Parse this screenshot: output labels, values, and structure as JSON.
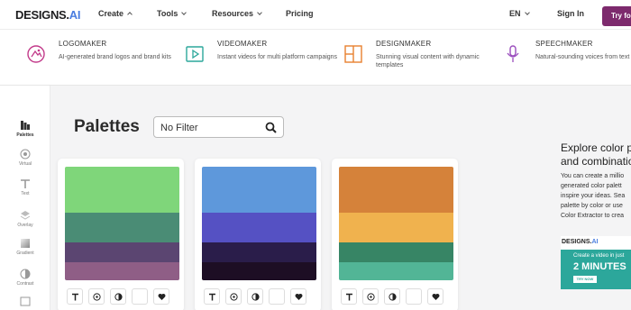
{
  "nav": {
    "logo_text": "DESIGNS.",
    "logo_ai": "AI",
    "items": [
      "Create",
      "Tools",
      "Resources",
      "Pricing"
    ],
    "lang": "EN",
    "signin": "Sign In",
    "cta": "Try for free"
  },
  "mega_menu": [
    {
      "title": "LOGOMAKER",
      "desc": "AI-generated brand logos and brand kits",
      "icon": "logo-icon"
    },
    {
      "title": "VIDEOMAKER",
      "desc": "Instant videos for multi platform campaigns",
      "icon": "video-play-icon"
    },
    {
      "title": "DESIGNMAKER",
      "desc": "Stunning visual content with dynamic templates",
      "icon": "layout-icon"
    },
    {
      "title": "SPEECHMAKER",
      "desc": "Natural-sounding voices from text script",
      "icon": "microphone-icon"
    }
  ],
  "sidebar": [
    {
      "label": "Palettes",
      "icon": "palette-icon",
      "active": true
    },
    {
      "label": "Virtual",
      "icon": "virtual-icon"
    },
    {
      "label": "Text",
      "icon": "text-icon"
    },
    {
      "label": "Overlay",
      "icon": "overlay-icon"
    },
    {
      "label": "Gradient",
      "icon": "gradient-icon"
    },
    {
      "label": "Contrast",
      "icon": "contrast-icon"
    }
  ],
  "page": {
    "title": "Palettes",
    "filter_value": "No Filter"
  },
  "palettes": [
    {
      "colors": [
        "#7fd67a",
        "#4a8c75",
        "#5b4571",
        "#8f5e86"
      ]
    },
    {
      "colors": [
        "#5e98db",
        "#5551c3",
        "#2a1d4a",
        "#1d0e24"
      ]
    },
    {
      "colors": [
        "#d5823a",
        "#f0b24e",
        "#378565",
        "#52b596"
      ]
    }
  ],
  "card_actions": [
    "text-icon",
    "target-icon",
    "contrast-icon",
    "gradient-icon",
    "heart-icon"
  ],
  "right_panel": {
    "title_line1": "Explore color pa",
    "title_line2": "and combinatio",
    "desc": [
      "You can create a millio",
      "generated color palett",
      "inspire your ideas. Sea",
      "palette by color or use",
      "Color Extractor to crea"
    ],
    "ad": {
      "logo": "DESIGNS.",
      "logo_ai": "AI",
      "line1": "Create a video in just",
      "line2": "2 MINUTES",
      "button": "TRY NOW"
    }
  }
}
